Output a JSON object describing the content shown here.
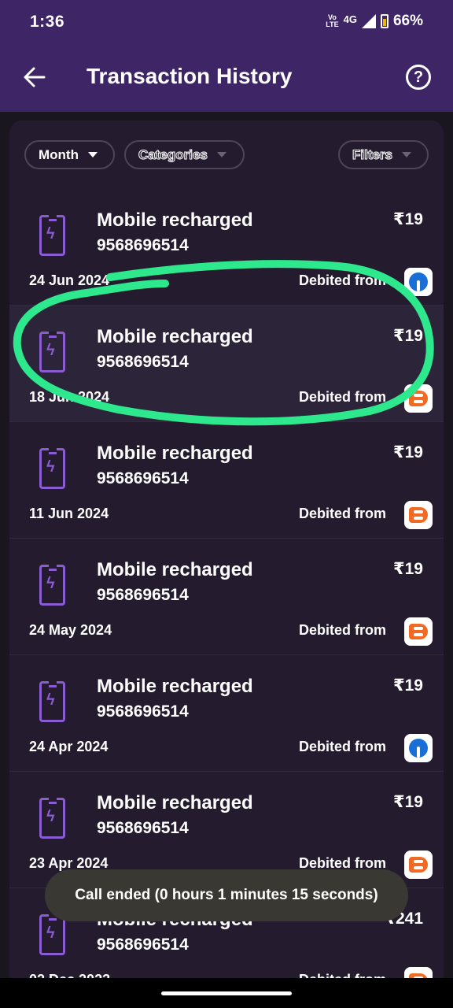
{
  "status_bar": {
    "time": "1:36",
    "volte_top": "Vo",
    "volte_bottom": "LTE",
    "network": "4G",
    "battery": "66%",
    "battery_color": "#f2b400"
  },
  "app_bar": {
    "title": "Transaction History",
    "back_icon": "arrow-left-icon",
    "help_icon": "question-circle-icon",
    "help_glyph": "?",
    "background": "#3d2566"
  },
  "filters": {
    "month": "Month",
    "categories": "Categories",
    "filters": "Filters"
  },
  "transactions": [
    {
      "title": "Mobile recharged",
      "number": "9568696514",
      "amount": "₹19",
      "date": "24 Jun 2024",
      "debited": "Debited from",
      "bank": "sbi"
    },
    {
      "title": "Mobile recharged",
      "number": "9568696514",
      "amount": "₹19",
      "date": "18 Jun 2024",
      "debited": "Debited from",
      "bank": "bob"
    },
    {
      "title": "Mobile recharged",
      "number": "9568696514",
      "amount": "₹19",
      "date": "11 Jun 2024",
      "debited": "Debited from",
      "bank": "bob"
    },
    {
      "title": "Mobile recharged",
      "number": "9568696514",
      "amount": "₹19",
      "date": "24 May 2024",
      "debited": "Debited from",
      "bank": "bob"
    },
    {
      "title": "Mobile recharged",
      "number": "9568696514",
      "amount": "₹19",
      "date": "24 Apr 2024",
      "debited": "Debited from",
      "bank": "sbi"
    },
    {
      "title": "Mobile recharged",
      "number": "9568696514",
      "amount": "₹19",
      "date": "23 Apr 2024",
      "debited": "Debited from",
      "bank": "bob"
    },
    {
      "title": "Mobile recharged",
      "number": "9568696514",
      "amount": "₹241",
      "date": "02 Dec 2023",
      "debited": "Debited from",
      "bank": "bob"
    }
  ],
  "toast": "Call ended (0 hours 1 minutes 15 seconds)",
  "annotation_color": "#2ee88e",
  "accent": "#8a5cd1"
}
